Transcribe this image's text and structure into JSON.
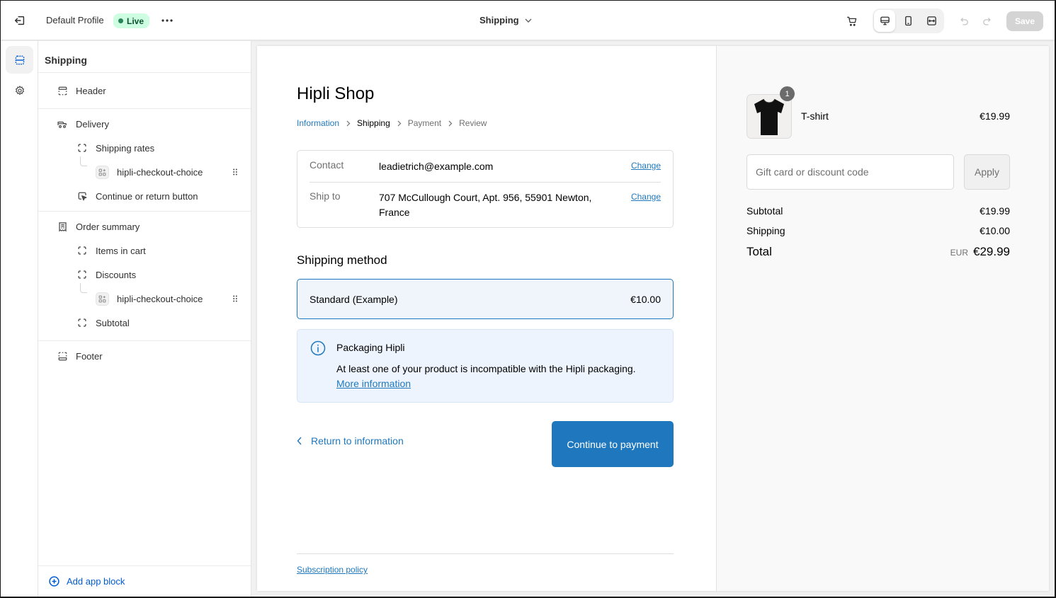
{
  "topbar": {
    "profile_name": "Default Profile",
    "live_badge": "Live",
    "page_selector": "Shipping",
    "save_label": "Save",
    "active_device": "desktop"
  },
  "rail": {
    "items": [
      {
        "icon": "sections-icon",
        "active": true
      },
      {
        "icon": "gear-icon",
        "active": false
      }
    ]
  },
  "sidebar": {
    "title": "Shipping",
    "sections": [
      {
        "label": "Header",
        "icon": "header-icon"
      },
      {
        "label": "Delivery",
        "icon": "truck-icon",
        "children": [
          {
            "label": "Shipping rates",
            "icon": "block-icon",
            "children": [
              {
                "label": "hipli-checkout-choice",
                "icon": "app-block-icon"
              }
            ]
          },
          {
            "label": "Continue or return button",
            "icon": "cursor-icon"
          }
        ]
      },
      {
        "label": "Order summary",
        "icon": "receipt-icon",
        "children": [
          {
            "label": "Items in cart",
            "icon": "block-icon"
          },
          {
            "label": "Discounts",
            "icon": "block-icon",
            "children": [
              {
                "label": "hipli-checkout-choice",
                "icon": "app-block-icon"
              }
            ]
          },
          {
            "label": "Subtotal",
            "icon": "block-icon"
          }
        ]
      },
      {
        "label": "Footer",
        "icon": "footer-icon"
      }
    ],
    "add_app_block": "Add app block"
  },
  "checkout": {
    "shop_name": "Hipli Shop",
    "breadcrumb": [
      {
        "label": "Information",
        "state": "link"
      },
      {
        "label": "Shipping",
        "state": "current"
      },
      {
        "label": "Payment",
        "state": "upcoming"
      },
      {
        "label": "Review",
        "state": "upcoming"
      }
    ],
    "review": {
      "contact_label": "Contact",
      "contact_value": "leadietrich@example.com",
      "ship_to_label": "Ship to",
      "ship_to_value": "707 McCullough Court, Apt. 956, 55901 Newton, France",
      "change_label": "Change"
    },
    "shipping_method_title": "Shipping method",
    "method": {
      "name": "Standard (Example)",
      "price": "€10.00"
    },
    "notice": {
      "title": "Packaging Hipli",
      "body": "At least one of your product is incompatible with the Hipli packaging.",
      "link": "More information"
    },
    "return_link": "Return to information",
    "continue_button": "Continue to payment",
    "policy_link": "Subscription policy"
  },
  "summary": {
    "item": {
      "name": "T-shirt",
      "price": "€19.99",
      "quantity": "1"
    },
    "discount_placeholder": "Gift card or discount code",
    "apply_label": "Apply",
    "subtotal_label": "Subtotal",
    "subtotal_value": "€19.99",
    "shipping_label": "Shipping",
    "shipping_value": "€10.00",
    "total_label": "Total",
    "currency": "EUR",
    "total_value": "€29.99"
  },
  "colors": {
    "accent": "#1f78bd",
    "admin_blue": "#005bd3",
    "live_bg": "#cdfee1",
    "live_dot": "#29845a"
  }
}
